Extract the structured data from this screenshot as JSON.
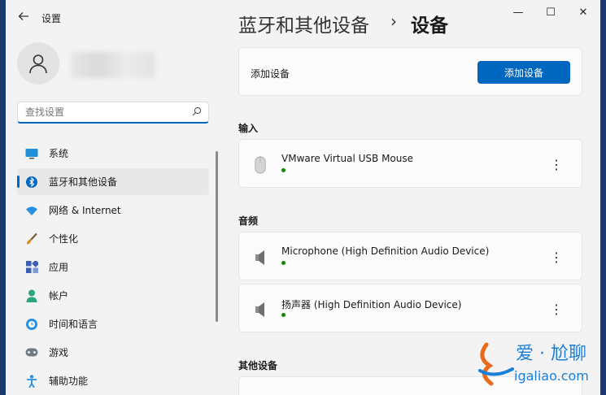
{
  "window": {
    "app_title": "设置",
    "controls": {
      "minimize": "—",
      "maximize": "☐",
      "close": "✕"
    }
  },
  "search": {
    "placeholder": "查找设置",
    "value": ""
  },
  "nav": {
    "items": [
      {
        "label": "系统",
        "icon": "monitor-icon"
      },
      {
        "label": "蓝牙和其他设备",
        "icon": "bluetooth-icon",
        "active": true
      },
      {
        "label": "网络 & Internet",
        "icon": "wifi-icon"
      },
      {
        "label": "个性化",
        "icon": "brush-icon"
      },
      {
        "label": "应用",
        "icon": "apps-icon"
      },
      {
        "label": "帐户",
        "icon": "account-icon"
      },
      {
        "label": "时间和语言",
        "icon": "clock-globe-icon"
      },
      {
        "label": "游戏",
        "icon": "gamepad-icon"
      },
      {
        "label": "辅助功能",
        "icon": "accessibility-icon"
      }
    ]
  },
  "breadcrumb": {
    "parent": "蓝牙和其他设备",
    "separator": "›",
    "current": "设备"
  },
  "add_device": {
    "label": "添加设备",
    "button": "添加设备"
  },
  "sections": {
    "input": {
      "title": "输入",
      "devices": [
        {
          "name": "VMware Virtual USB Mouse",
          "icon": "mouse-icon",
          "status_color": "#108a00"
        }
      ]
    },
    "audio": {
      "title": "音频",
      "devices": [
        {
          "name": "Microphone (High Definition Audio Device)",
          "icon": "speaker-icon",
          "status_color": "#108a00"
        },
        {
          "name": "扬声器 (High Definition Audio Device)",
          "icon": "speaker-icon",
          "status_color": "#108a00"
        }
      ]
    },
    "other": {
      "title": "其他设备"
    }
  },
  "more_label": "⋮",
  "watermark": {
    "line1": "爱 · 尬聊",
    "line2": "igaliao.com"
  },
  "colors": {
    "accent": "#0067c0",
    "status": "#108a00",
    "background": "#f3f3f3",
    "card": "#fbfbfb"
  }
}
